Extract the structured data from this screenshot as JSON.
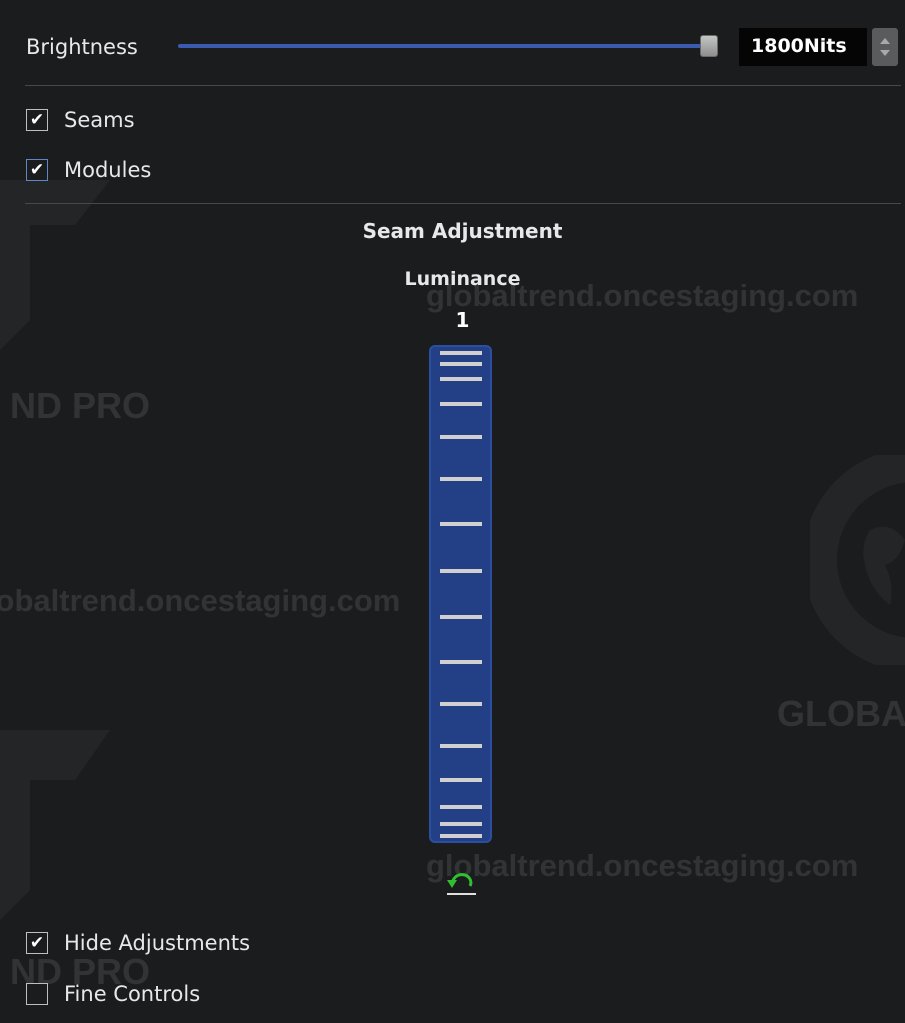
{
  "brightness": {
    "label": "Brightness",
    "value_text": "1800Nits",
    "slider_level": 1.0,
    "spin_icon": "spinner-updown-icon"
  },
  "display_options": [
    {
      "label": "Seams",
      "checked": true
    },
    {
      "label": "Modules",
      "checked": true
    }
  ],
  "seam_adjustment": {
    "title": "Seam Adjustment",
    "control_label": "Luminance",
    "value": "1",
    "reset_icon": "reset-undo-icon"
  },
  "bottom_options": [
    {
      "label": "Hide Adjustments",
      "checked": true
    },
    {
      "label": "Fine Controls",
      "checked": false
    }
  ],
  "check_glyph": "✔",
  "watermarks": {
    "url_text": "globaltrend.oncestaging.com",
    "brand_fragment": "ND PRO",
    "logo_fragment": "GLOBA"
  },
  "colors": {
    "background": "#1b1c1e",
    "accent_blue": "#3a5bb0",
    "slider_fill": "#233f86",
    "reset_green": "#2fbf2f"
  }
}
